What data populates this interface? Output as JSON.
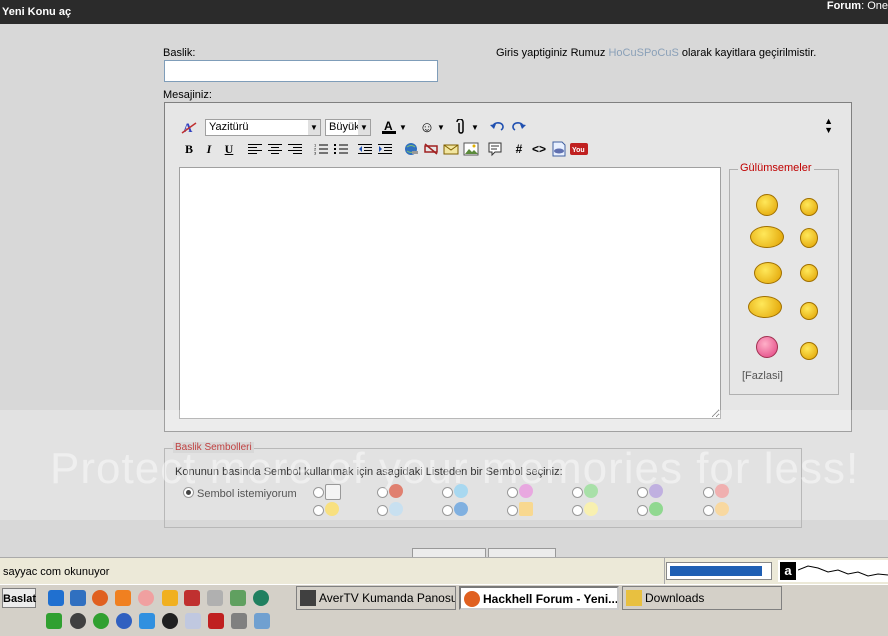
{
  "header": {
    "title": "Yeni Konu aç",
    "forum_label": "Forum",
    "forum_value": ": One"
  },
  "form": {
    "subject_label": "Baslik:",
    "subject_value": "",
    "login_prefix": "Giris yaptiginiz Rumuz",
    "login_nick": "HoCuSPoCuS",
    "login_suffix": "olarak kayitlara geçirilmistir.",
    "message_label": "Mesajiniz:"
  },
  "editor": {
    "font_select": "Yazitürü",
    "size_select": "Büyük",
    "message_value": ""
  },
  "smilies": {
    "legend": "Gülümsemeler",
    "more": "[Fazlasi]"
  },
  "symbols": {
    "legend": "Baslik Sembolleri",
    "instruction": "Konunun basinda Sembol kullanmak için asagidaki Listeden bir Sembol seçiniz:",
    "no_symbol": "Sembol istemiyorum"
  },
  "watermark": "Protect more of your memories for less!",
  "statusbar": {
    "text": "sayyac com okunuyor",
    "progress": 0.88
  },
  "taskbar": {
    "start": "Baslat",
    "tasks": [
      {
        "label": "AverTV Kumanda Panosu"
      },
      {
        "label": "Hackhell Forum - Yeni..."
      },
      {
        "label": "Downloads"
      }
    ]
  },
  "colors": {
    "header_bg": "#2b2b2b",
    "nick": "#8aa0b8",
    "legend_red": "#c00000",
    "progress": "#1f5fb4"
  }
}
